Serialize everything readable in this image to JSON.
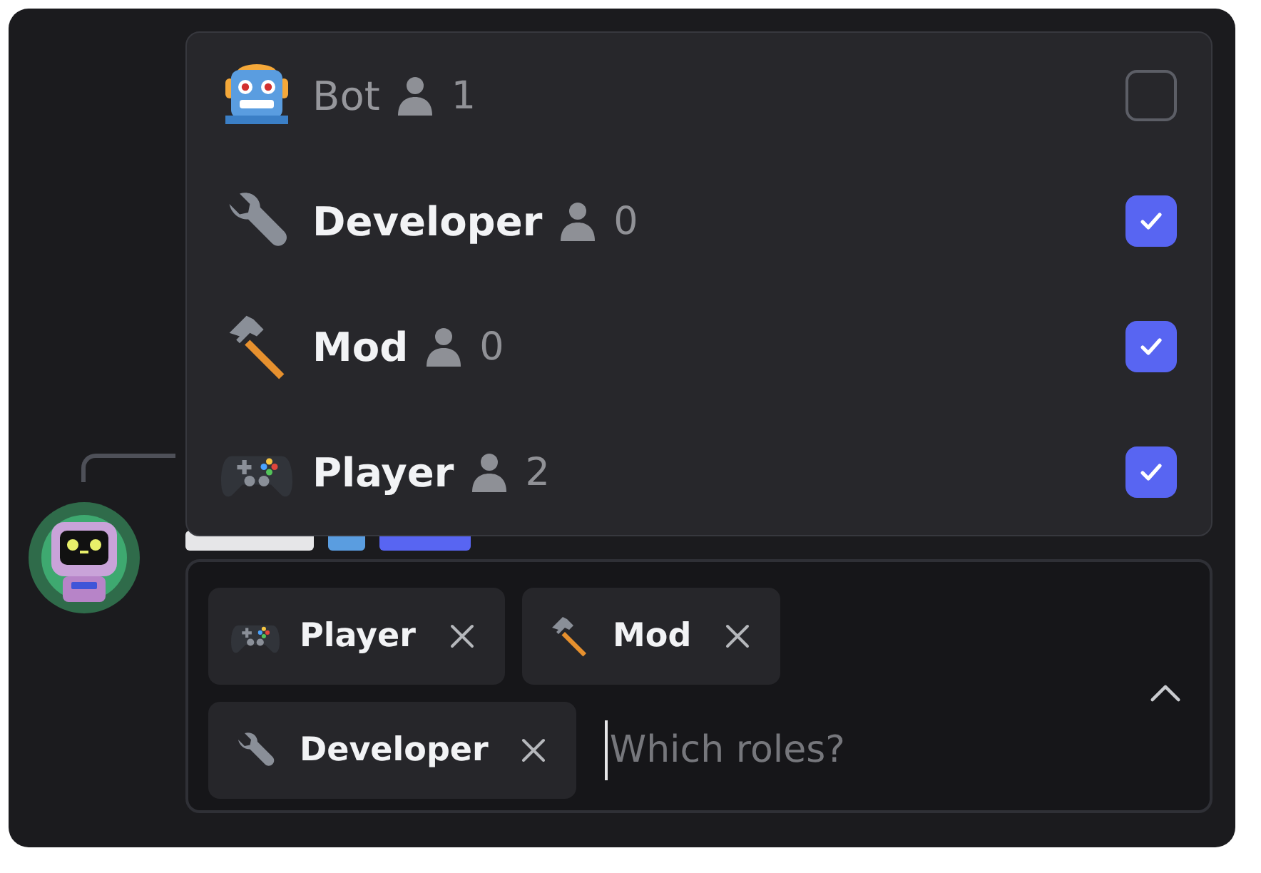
{
  "roles_menu": {
    "options": [
      {
        "kind": "robot",
        "name": "Bot",
        "member_count": "1",
        "checked": false
      },
      {
        "kind": "wrench",
        "name": "Developer",
        "member_count": "0",
        "checked": true
      },
      {
        "kind": "hammer",
        "name": "Mod",
        "member_count": "0",
        "checked": true
      },
      {
        "kind": "gamepad",
        "name": "Player",
        "member_count": "2",
        "checked": true
      }
    ]
  },
  "role_picker": {
    "chips": [
      {
        "kind": "gamepad",
        "name": "Player"
      },
      {
        "kind": "hammer",
        "name": "Mod"
      },
      {
        "kind": "wrench",
        "name": "Developer"
      }
    ],
    "placeholder": "Which roles?",
    "expanded": true
  }
}
